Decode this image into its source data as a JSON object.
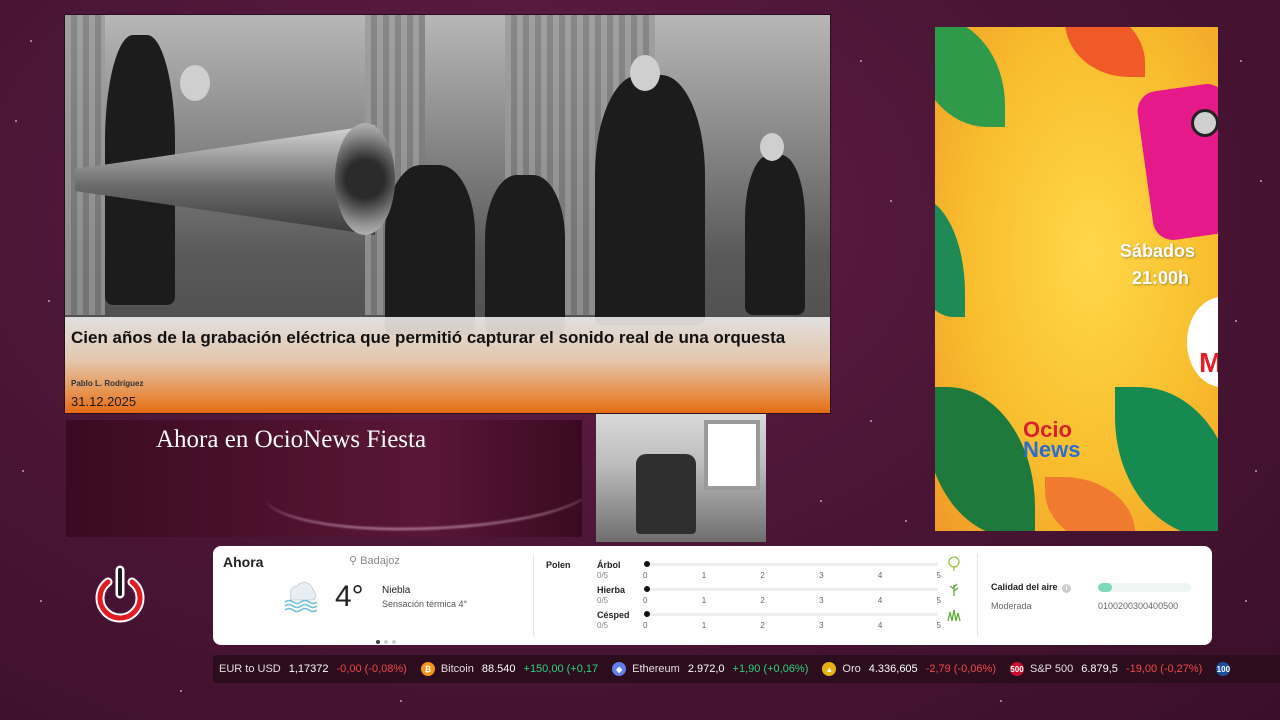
{
  "news": {
    "title": "Cien años de la grabación eléctrica que permitió capturar el sonido real de una orquesta",
    "author": "Pablo L. Rodríguez",
    "date": "31.12.2025"
  },
  "now_playing": {
    "text": "Ahora en OcioNews Fiesta"
  },
  "promo": {
    "day": "Sábados",
    "time": "21:00h",
    "badge_letter": "M",
    "logo_top": "Ocio",
    "logo_bottom": "News"
  },
  "weather": {
    "now_label": "Ahora",
    "location": "Badajoz",
    "temperature": "4°",
    "condition": "Niebla",
    "feels_like": "Sensación térmica 4°",
    "pollen_title": "Polen",
    "pollen": [
      {
        "name": "Árbol",
        "value": "0/5",
        "level": 0
      },
      {
        "name": "Hierba",
        "value": "0/5",
        "level": 0
      },
      {
        "name": "Césped",
        "value": "0/5",
        "level": 0
      }
    ],
    "pollen_ticks": [
      "0",
      "1",
      "2",
      "3",
      "4",
      "5"
    ],
    "air_label": "Calidad del aire",
    "air_info": "i",
    "air_level": "Moderada",
    "air_scale": "0100200300400500",
    "air_fraction": 0.15
  },
  "ticker": [
    {
      "name": "EUR to USD",
      "price": "1,17372",
      "change": "-0,00 (-0,08%)",
      "dir": "dn",
      "icon_color": "#2b0d1d",
      "icon": ""
    },
    {
      "name": "Bitcoin",
      "price": "88.540",
      "change": "+150,00 (+0,17",
      "dir": "up",
      "icon_color": "#f7931a",
      "icon": "₿"
    },
    {
      "name": "Ethereum",
      "price": "2.972,0",
      "change": "+1,90 (+0,06%)",
      "dir": "up",
      "icon_color": "#627eea",
      "icon": "◆"
    },
    {
      "name": "Oro",
      "price": "4.336,605",
      "change": "-2,79 (-0,06%)",
      "dir": "dn",
      "icon_color": "#e5b20f",
      "icon": "▲"
    },
    {
      "name": "S&P 500",
      "price": "6.879,5",
      "change": "-19,00 (-0,27%)",
      "dir": "dn",
      "icon_color": "#c8102e",
      "icon": "500"
    },
    {
      "name": "",
      "price": "",
      "change": "",
      "dir": "up",
      "icon_color": "#1b4f9c",
      "icon": "100"
    }
  ]
}
